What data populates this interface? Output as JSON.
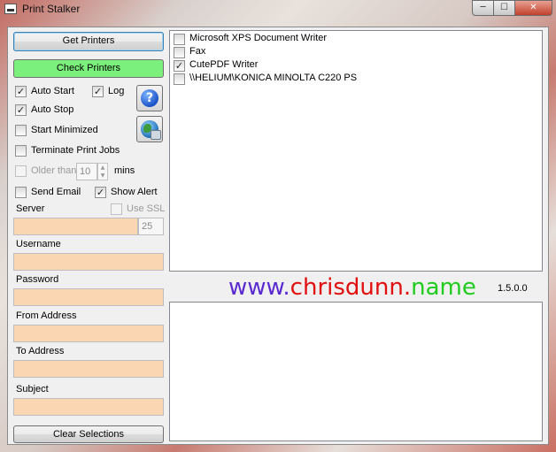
{
  "window": {
    "title": "Print Stalker",
    "min_glyph": "─",
    "max_glyph": "☐",
    "close_glyph": "✕"
  },
  "left": {
    "get_printers": "Get Printers",
    "check_printers": "Check Printers",
    "auto_start": "Auto Start",
    "log": "Log",
    "auto_stop": "Auto Stop",
    "start_minimized": "Start Minimized",
    "terminate_print_jobs": "Terminate Print Jobs",
    "older_than": "Older than",
    "older_than_value": "10",
    "mins": "mins",
    "send_email": "Send Email",
    "show_alert": "Show Alert",
    "server": "Server",
    "use_ssl": "Use SSL",
    "port_value": "25",
    "username": "Username",
    "password": "Password",
    "from_address": "From Address",
    "to_address": "To Address",
    "subject": "Subject",
    "clear_selections": "Clear Selections"
  },
  "checks": {
    "auto_start": true,
    "log": true,
    "auto_stop": true,
    "start_minimized": false,
    "terminate_print_jobs": false,
    "older_than": false,
    "send_email": false,
    "show_alert": true,
    "use_ssl": false
  },
  "printers": [
    {
      "name": "Microsoft XPS Document Writer",
      "checked": false
    },
    {
      "name": "Fax",
      "checked": false
    },
    {
      "name": "CutePDF Writer",
      "checked": true
    },
    {
      "name": "\\\\HELIUM\\KONICA MINOLTA C220 PS",
      "checked": false
    }
  ],
  "branding": {
    "www": "www.",
    "chrisdunn": "chrisdunn",
    "dot": ".",
    "name": "name",
    "version": "1.5.0.0"
  },
  "colors": {
    "www": "#5a2ad0",
    "chrisdunn": "#e01010",
    "dot": "#e01010",
    "name": "#1fcc1f",
    "field_bg": "#fbd6b2",
    "check_button_bg": "#7cf07c"
  },
  "icons": {
    "help": "help-icon",
    "web": "globe-icon",
    "window": "printer-icon"
  }
}
